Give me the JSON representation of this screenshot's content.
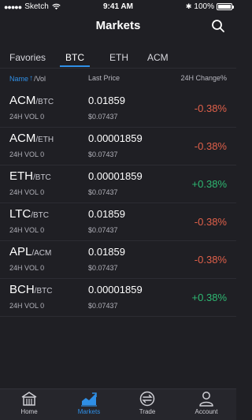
{
  "status": {
    "carrier": "Sketch",
    "time": "9:41 AM",
    "battery": "100%"
  },
  "nav": {
    "title": "Markets",
    "search_icon": "search-icon"
  },
  "tabs": [
    {
      "label": "Favories",
      "active": false
    },
    {
      "label": "BTC",
      "active": true
    },
    {
      "label": "ETH",
      "active": false
    },
    {
      "label": "ACM",
      "active": false
    }
  ],
  "headers": {
    "name": "Name",
    "vol": "/Vol",
    "price": "Last Price",
    "change": "24H Change%"
  },
  "colors": {
    "accent": "#2f8fe6",
    "negative": "#e0604a",
    "positive": "#2eb872"
  },
  "rows": [
    {
      "base": "ACM",
      "quote": "/BTC",
      "vol": "24H VOL 0",
      "price": "0.01859",
      "fiat": "$0.07437",
      "change": "-0.38%",
      "trend": "negative"
    },
    {
      "base": "ACM",
      "quote": "/ETH",
      "vol": "24H VOL 0",
      "price": "0.00001859",
      "fiat": "$0.07437",
      "change": "-0.38%",
      "trend": "negative"
    },
    {
      "base": "ETH",
      "quote": "/BTC",
      "vol": "24H VOL 0",
      "price": "0.00001859",
      "fiat": "$0.07437",
      "change": "+0.38%",
      "trend": "positive"
    },
    {
      "base": "LTC",
      "quote": "/BTC",
      "vol": "24H VOL 0",
      "price": "0.01859",
      "fiat": "$0.07437",
      "change": "-0.38%",
      "trend": "negative"
    },
    {
      "base": "APL",
      "quote": "/ACM",
      "vol": "24H VOL 0",
      "price": "0.01859",
      "fiat": "$0.07437",
      "change": "-0.38%",
      "trend": "negative"
    },
    {
      "base": "BCH",
      "quote": "/BTC",
      "vol": "24H VOL 0",
      "price": "0.00001859",
      "fiat": "$0.07437",
      "change": "+0.38%",
      "trend": "positive"
    }
  ],
  "tabbar": [
    {
      "label": "Home",
      "icon": "home-icon",
      "active": false
    },
    {
      "label": "Markets",
      "icon": "chart-icon",
      "active": true
    },
    {
      "label": "Trade",
      "icon": "exchange-icon",
      "active": false
    },
    {
      "label": "Account",
      "icon": "user-icon",
      "active": false
    }
  ]
}
